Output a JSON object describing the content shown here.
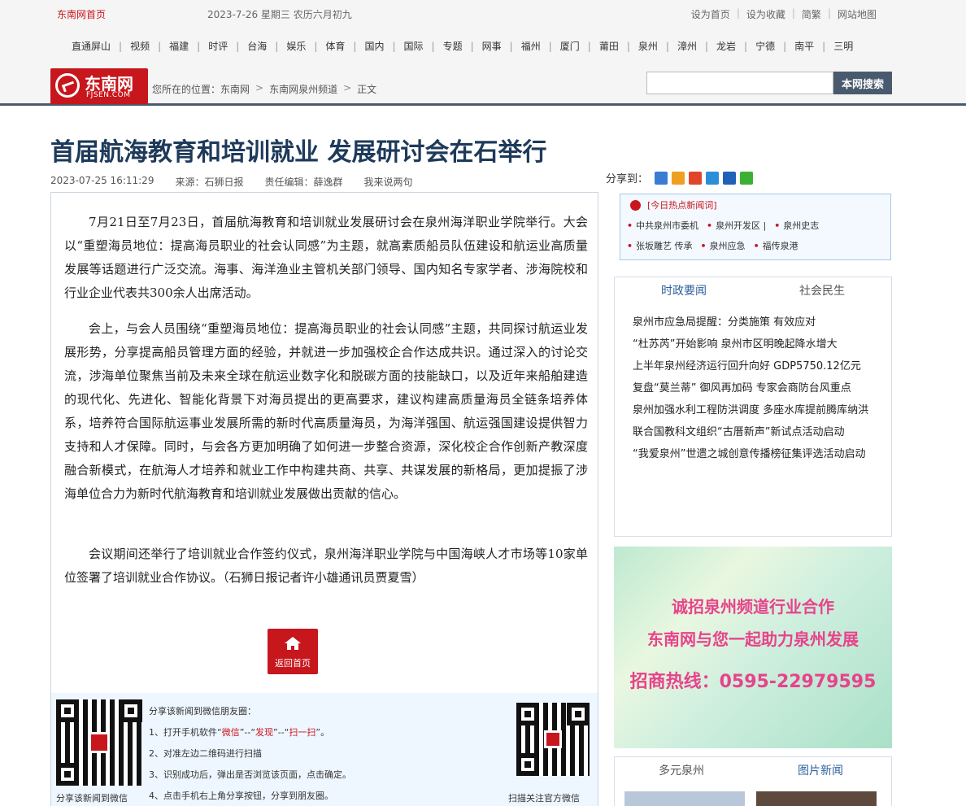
{
  "topbar": {
    "home": "东南网首页",
    "date": "2023-7-26  星期三  农历六月初九",
    "links": [
      "设为首页",
      "设为收藏",
      "简繁",
      "网站地图"
    ]
  },
  "nav": {
    "items": [
      "直通屏山",
      "视频",
      "福建",
      "时评",
      "台海",
      "娱乐",
      "体育",
      "国内",
      "国际",
      "专题",
      "网事",
      "福州",
      "厦门",
      "莆田",
      "泉州",
      "漳州",
      "龙岩",
      "宁德",
      "南平",
      "三明"
    ]
  },
  "logo": {
    "cn": "东南网",
    "en": "FJSEN.COM"
  },
  "breadcrumb": {
    "prefix": "您所在的位置：",
    "items": [
      "东南网",
      "东南网泉州频道",
      "正文"
    ],
    "sep": ">"
  },
  "search": {
    "button": "本网搜索",
    "placeholder": ""
  },
  "article": {
    "title": "首届航海教育和培训就业 发展研讨会在石举行",
    "datetime": "2023-07-25 16:11:29",
    "source": "来源：石狮日报",
    "editor": "责任编辑：薛逸群",
    "comment": "我来说两句",
    "share_label": "分享到：",
    "p1": "7月21日至7月23日，首届航海教育和培训就业发展研讨会在泉州海洋职业学院举行。大会以“重塑海员地位：提高海员职业的社会认同感”为主题，就高素质船员队伍建设和航运业高质量发展等话题进行广泛交流。海事、海洋渔业主管机关部门领导、国内知名专家学者、涉海院校和行业企业代表共300余人出席活动。",
    "p2": "会上，与会人员围绕“重塑海员地位：提高海员职业的社会认同感”主题，共同探讨航运业发展形势，分享提高船员管理方面的经验，并就进一步加强校企合作达成共识。通过深入的讨论交流，涉海单位聚焦当前及未来全球在航运业数字化和脱碳方面的技能缺口，以及近年来船舶建造的现代化、先进化、智能化背景下对海员提出的更高要求，建议构建高质量海员全链条培养体系，培养符合国际航运事业发展所需的新时代高质量海员，为海洋强国、航运强国建设提供智力支持和人才保障。同时，与会各方更加明确了如何进一步整合资源，深化校企合作创新产教深度融合新模式，在航海人才培养和就业工作中构建共商、共享、共谋发展的新格局，更加提振了涉海单位合力为新时代航海教育和培训就业发展做出贡献的信心。",
    "p3": "会议期间还举行了培训就业合作签约仪式，泉州海洋职业学院与中国海峡人才市场等10家单位签署了培训就业合作协议。（石狮日报记者许小雄通讯员贾夏雪）",
    "back_home": "返回首页"
  },
  "wechat": {
    "intro": "分享该新闻到微信朋友圈：",
    "step1_a": "1、打开手机软件“",
    "step1_b": "微信",
    "step1_c": "”--“",
    "step1_d": "发现",
    "step1_e": "”--“",
    "step1_f": "扫一扫",
    "step1_g": "”。",
    "step2": "2、对准左边二维码进行扫描",
    "step3": "3、识别成功后，弹出是否浏览该页面，点击确定。",
    "step4": "4、点击手机右上角分享按钮，分享到朋友圈。",
    "qr_left_caption": "分享该新闻到微信",
    "qr_right_caption": "扫描关注官方微信"
  },
  "sidebar": {
    "hot_title": "[今日热点新闻词]",
    "hot_row1": [
      "中共泉州市委机",
      "泉州开发区",
      "泉州史志"
    ],
    "hot_row2": [
      "张坂雕艺 传承",
      "泉州应急",
      "福传泉港"
    ],
    "tabs": [
      "时政要闻",
      "社会民生"
    ],
    "news": [
      "泉州市应急局提醒：分类施策 有效应对",
      "“杜苏芮”开始影响 泉州市区明晚起降水增大",
      "上半年泉州经济运行回升向好 GDP5750.12亿元",
      "复盘“莫兰蒂” 御风再加码 专家会商防台风重点",
      "泉州加强水利工程防洪调度 多座水库提前腾库纳洪",
      "联合国教科文组织“古厝新声”新试点活动启动",
      "“我爱泉州”世遗之城创意传播榜征集评选活动启动"
    ],
    "ad_line1": "诚招泉州频道行业合作",
    "ad_line2": "东南网与您一起助力泉州发展",
    "ad_line3": "招商热线：0595-22979595",
    "bottom_tabs": [
      "多元泉州",
      "图片新闻"
    ]
  },
  "colors": {
    "brand_red": "#c8161d",
    "title_blue": "#1e3a5a",
    "link_blue": "#2c5f9e",
    "header_bar": "#4a5a6e"
  }
}
